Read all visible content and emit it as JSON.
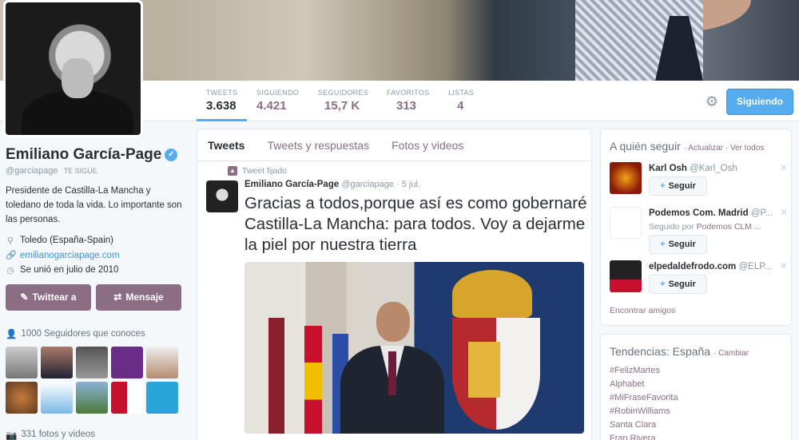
{
  "profile": {
    "name": "Emiliano García-Page",
    "handle": "@garciapage",
    "follows_you": "TE SIGUE",
    "bio": "Presidente de Castilla-La Mancha y toledano de toda la vida. Lo importante son las personas.",
    "location": "Toledo (España-Spain)",
    "website": "emilianogarciapage.com",
    "joined": "Se unió en julio de 2010",
    "tweet_to_label": "Twittear a",
    "message_label": "Mensaje",
    "known_followers": "1000 Seguidores que conoces",
    "media_count": "331 fotos y videos"
  },
  "stats": [
    {
      "label": "TWEETS",
      "value": "3.638"
    },
    {
      "label": "SIGUIENDO",
      "value": "4.421"
    },
    {
      "label": "SEGUIDORES",
      "value": "15,7 K"
    },
    {
      "label": "FAVORITOS",
      "value": "313"
    },
    {
      "label": "LISTAS",
      "value": "4"
    }
  ],
  "following_button": "Siguiendo",
  "timeline": {
    "tabs": [
      "Tweets",
      "Tweets y respuestas",
      "Fotos y videos"
    ],
    "pinned_label": "Tweet fijado",
    "tweet": {
      "author": "Emiliano García-Page",
      "handle": "@garciapage",
      "date": "· 5 jul.",
      "text": "Gracias a todos,porque así es como gobernaré Castilla-La Mancha: para todos. Voy a dejarme la piel por nuestra tierra"
    }
  },
  "who_to_follow": {
    "title": "A quién seguir",
    "refresh": "Actualizar",
    "view_all": "Ver todos",
    "follow_label": "Seguir",
    "find_friends": "Encontrar amigos",
    "suggestions": [
      {
        "name": "Karl Ösh",
        "handle": "@Karl_Osh",
        "followed_by_prefix": "",
        "followed_by": ""
      },
      {
        "name": "Podemos Com. Madrid",
        "handle": "@P...",
        "followed_by_prefix": "Seguido por",
        "followed_by": "Podemos CLM ..."
      },
      {
        "name": "elpedaldefrodo.com",
        "handle": "@ELP...",
        "followed_by_prefix": "",
        "followed_by": ""
      }
    ]
  },
  "trends": {
    "title": "Tendencias: España",
    "change": "Cambiar",
    "items": [
      "#FelizMartes",
      "Alphabet",
      "#MiFraseFavorita",
      "#RobinWilliams",
      "Santa Clara",
      "Fran Rivera"
    ]
  },
  "colors": {
    "accent": "#55acee",
    "brand": "#8b6d84"
  }
}
